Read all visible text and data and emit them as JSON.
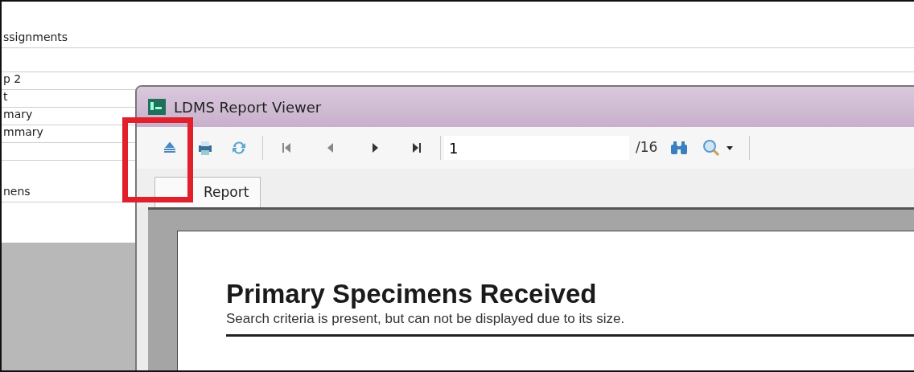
{
  "background_list": {
    "items": [
      {
        "kind": "text",
        "label": "ssignments"
      },
      {
        "kind": "blank"
      },
      {
        "kind": "text",
        "label": "p 2"
      },
      {
        "kind": "text",
        "label": "t"
      },
      {
        "kind": "text",
        "label": "mary"
      },
      {
        "kind": "text",
        "label": "mmary"
      },
      {
        "kind": "blank"
      },
      {
        "kind": "text",
        "label": "nens"
      }
    ]
  },
  "report_window": {
    "title": "LDMS Report Viewer",
    "toolbar": {
      "page_field": {
        "value": "1"
      },
      "page_total": "/16"
    },
    "tabs": [
      {
        "label": "Report",
        "selected": true
      }
    ],
    "export_highlighted": true,
    "report": {
      "heading": "Primary Specimens Received",
      "subtitle": "Search criteria is present, but can not be displayed due to its size."
    }
  }
}
